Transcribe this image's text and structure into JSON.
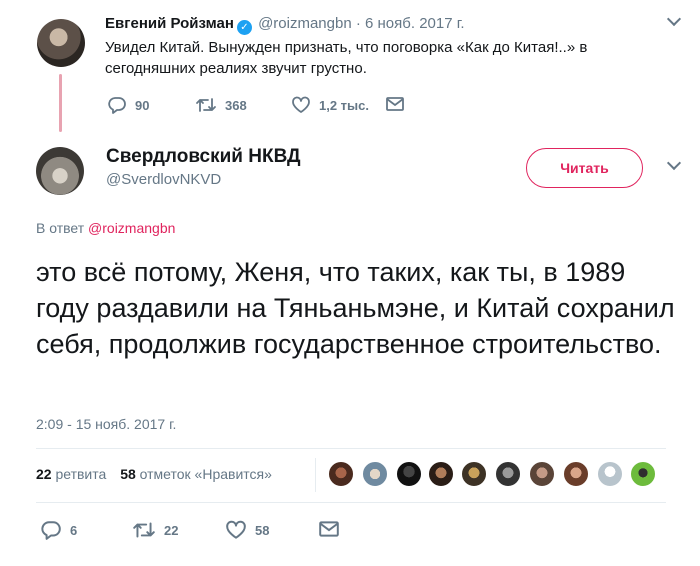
{
  "parent_tweet": {
    "name": "Евгений Ройзман",
    "verified_mark": "✓",
    "handle": "@roizmangbn",
    "separator": "·",
    "date": "6 нояб. 2017 г.",
    "text": "Увидел Китай. Вынужден признать, что поговорка «Как до Китая!..» в сегодняшних реалиях звучит грустно.",
    "actions": {
      "replies": "90",
      "retweets": "368",
      "likes": "1,2 тыс."
    }
  },
  "main_tweet": {
    "name": "Свердловский НКВД",
    "handle": "@SverdlovNKVD",
    "follow_label": "Читать",
    "reply_prefix": "В ответ",
    "reply_mention": "@roizmangbn",
    "text": "это всё потому, Женя, что таких, как ты, в 1989 году раздавили на Тяньаньмэне, и Китай сохранил себя, продолжив государственное строительство.",
    "timestamp": "2:09 - 15 нояб. 2017 г.",
    "stats": {
      "retweets_count": "22",
      "retweets_label": "ретвита",
      "likes_count": "58",
      "likes_label": "отметок «Нравится»"
    },
    "actions": {
      "replies": "6",
      "retweets": "22",
      "likes": "58"
    }
  },
  "icons": [
    "chevron-down-icon",
    "verified-badge-icon",
    "reply-icon",
    "retweet-icon",
    "like-icon",
    "direct-message-icon"
  ],
  "colors": {
    "accent": "#e0245e",
    "verified": "#1da1f2",
    "muted": "#657786",
    "thread_line": "#e8a3b1"
  }
}
